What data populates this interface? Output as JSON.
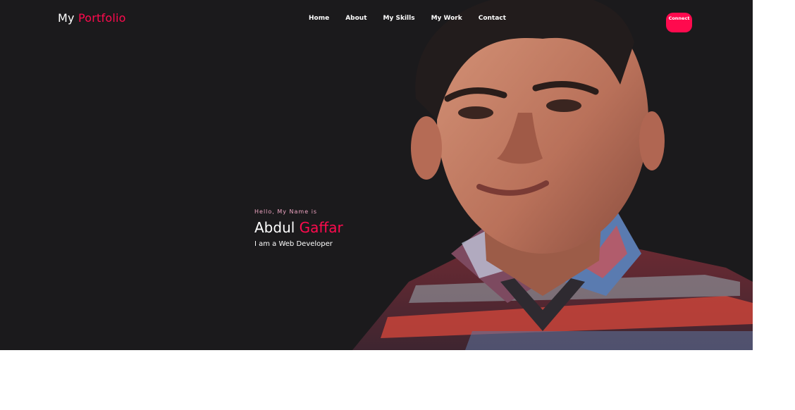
{
  "header": {
    "logo_first": "My",
    "logo_accent": "Portfolio",
    "nav": [
      {
        "label": "Home"
      },
      {
        "label": "About"
      },
      {
        "label": "My Skills"
      },
      {
        "label": "My Work"
      },
      {
        "label": "Contact"
      }
    ],
    "connect_label": "Connect"
  },
  "hero": {
    "greeting": "Hello, My Name is",
    "first_name": "Abdul",
    "last_name": "Gaffar",
    "role": "I am a Web Developer"
  },
  "colors": {
    "background": "#1b1a1c",
    "accent": "#ff0a4e",
    "text": "#ffffff",
    "greeting": "#f0a6c3"
  }
}
